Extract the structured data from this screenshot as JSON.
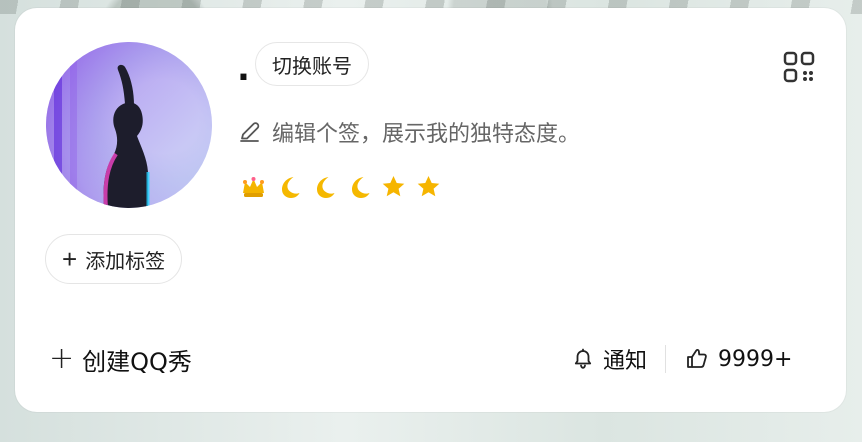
{
  "profile": {
    "name_display": ".",
    "switch_account_label": "切换账号",
    "signature_text": "编辑个签，展示我的独特态度。",
    "add_tag_label": "添加标签",
    "create_qq_show_label": "创建QQ秀",
    "notify_label": "通知",
    "likes_count": "9999+"
  },
  "icons": {
    "qr": "qr-code-icon",
    "pen": "edit-pen-icon",
    "plus": "plus-icon",
    "bell": "bell-icon",
    "thumb": "thumbs-up-icon"
  },
  "badges": [
    "crown",
    "moon",
    "moon",
    "moon",
    "star",
    "star"
  ],
  "colors": {
    "card_background": "#ffffff",
    "text_primary": "#111111",
    "text_secondary": "#666666",
    "badge_gold": "#f5b800",
    "border_light": "#e5e5e5"
  }
}
